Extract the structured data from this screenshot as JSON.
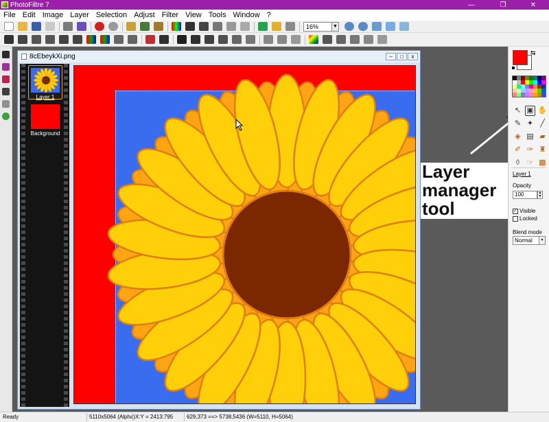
{
  "app": {
    "title": "PhotoFiltre 7"
  },
  "window_controls": {
    "minimize": "—",
    "maximize": "❐",
    "close": "✕"
  },
  "menu": [
    "File",
    "Edit",
    "Image",
    "Layer",
    "Selection",
    "Adjust",
    "Filter",
    "View",
    "Tools",
    "Window",
    "?"
  ],
  "toolbar": {
    "zoom_value": "16%"
  },
  "document": {
    "title": "8cEbeykXi.png",
    "layers": [
      {
        "label": "Layer 1",
        "selected": true
      },
      {
        "label": "Background",
        "selected": false
      }
    ]
  },
  "right_panel": {
    "foreground_color": "#ff0000",
    "background_color": "#ffffff",
    "current_layer": "Layer 1",
    "opacity_label": "Opacity",
    "opacity_value": "100",
    "visible_label": "Visible",
    "visible_checked": true,
    "locked_label": "Locked",
    "locked_checked": false,
    "blend_mode_label": "Blend mode",
    "blend_mode_value": "Normal"
  },
  "annotation": {
    "line1": "Layer",
    "line2": "manager",
    "line3": "tool"
  },
  "statusbar": {
    "status": "Ready",
    "image_info": "5110x5064 (Alpha)",
    "cursor": "X:Y = 2413:795",
    "selection": "629,373 ==> 5738,5436 (W=5110, H=5064)"
  },
  "colors": {
    "titlebar": "#9b1fa8",
    "canvas_red": "#ff0000",
    "canvas_blue": "#3a6cf0",
    "petal_yellow": "#ffd00a",
    "petal_orange": "#ffa514",
    "petal_outline": "#e07d10",
    "center_brown": "#7b2800"
  }
}
